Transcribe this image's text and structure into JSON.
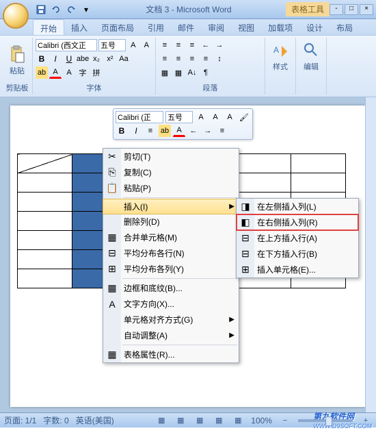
{
  "title": "文档 3 - Microsoft Word",
  "table_tools": "表格工具",
  "tabs": {
    "start": "开始",
    "insert": "插入",
    "layout": "页面布局",
    "ref": "引用",
    "mail": "邮件",
    "review": "审阅",
    "view": "视图",
    "addin": "加载项",
    "design": "设计",
    "tlayout": "布局"
  },
  "ribbon": {
    "clipboard": {
      "paste": "粘贴",
      "label": "剪贴板"
    },
    "font": {
      "name": "Calibri (西文正",
      "size": "五号",
      "label": "字体"
    },
    "para": {
      "label": "段落"
    },
    "styles": {
      "btn": "样式",
      "label": ""
    },
    "edit": {
      "btn": "编辑",
      "label": ""
    }
  },
  "mini": {
    "font": "Calibri (正",
    "size": "五号"
  },
  "menu": {
    "cut": "剪切(T)",
    "copy": "复制(C)",
    "paste": "粘贴(P)",
    "insert": "插入(I)",
    "delcol": "删除列(D)",
    "merge": "合并单元格(M)",
    "distrow": "平均分布各行(N)",
    "distcol": "平均分布各列(Y)",
    "border": "边框和底纹(B)...",
    "textdir": "文字方向(X)...",
    "align": "单元格对齐方式(G)",
    "autofit": "自动调整(A)",
    "props": "表格属性(R)..."
  },
  "submenu": {
    "insleft": "在左侧插入列(L)",
    "insright": "在右侧插入列(R)",
    "insabove": "在上方插入行(A)",
    "insbelow": "在下方插入行(B)",
    "inscell": "插入单元格(E)..."
  },
  "status": {
    "page": "页面: 1/1",
    "words": "字数: 0",
    "lang": "英语(美国)",
    "zoom": "100%"
  },
  "watermark": {
    "main": "第九软件网",
    "sub": "WWW.D9SOFT.COM"
  }
}
